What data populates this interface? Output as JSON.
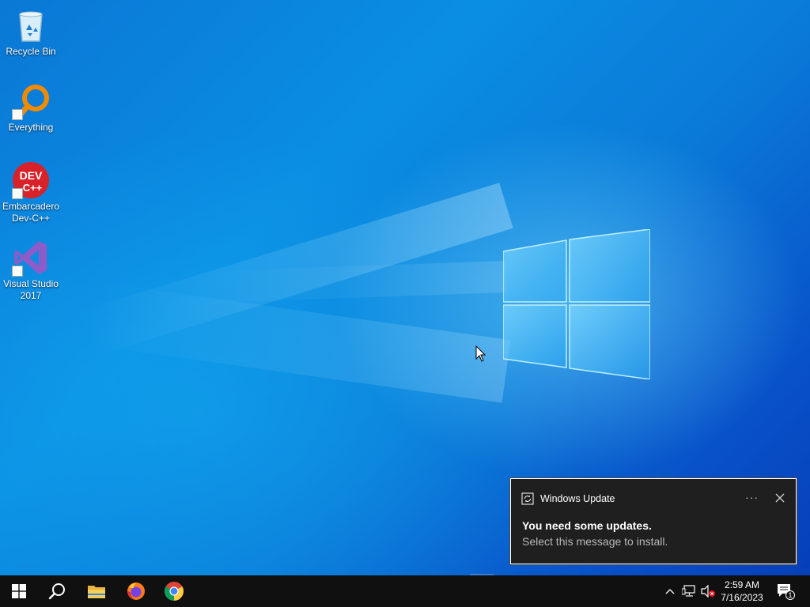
{
  "desktop": {
    "icons": [
      {
        "label": "Recycle Bin",
        "icon": "recycle-bin-icon"
      },
      {
        "label": "Everything",
        "icon": "everything-search-icon"
      },
      {
        "label": "Embarcadero Dev-C++",
        "icon": "dev-cpp-icon",
        "logo_text": "DEV C++"
      },
      {
        "label": "Visual Studio 2017",
        "icon": "visual-studio-icon"
      }
    ],
    "colors": {
      "accent": "#0a78d6",
      "logo_glow": "#9fe4ff"
    }
  },
  "notification": {
    "app_name": "Windows Update",
    "more_label": "···",
    "title": "You need some updates.",
    "body": "Select this message to install.",
    "icons": {
      "app": "update-icon",
      "close": "close-icon"
    }
  },
  "taskbar": {
    "buttons": [
      {
        "name": "start",
        "icon": "windows-logo-icon"
      },
      {
        "name": "search",
        "icon": "search-icon"
      },
      {
        "name": "file-explorer",
        "icon": "folder-icon"
      },
      {
        "name": "firefox",
        "icon": "firefox-icon"
      },
      {
        "name": "chrome",
        "icon": "chrome-icon"
      }
    ],
    "tray": {
      "icons": [
        "chevron-up-icon",
        "network-icon",
        "volume-muted-icon"
      ],
      "time": "2:59 AM",
      "date": "7/16/2023",
      "notification_count": "1"
    }
  }
}
